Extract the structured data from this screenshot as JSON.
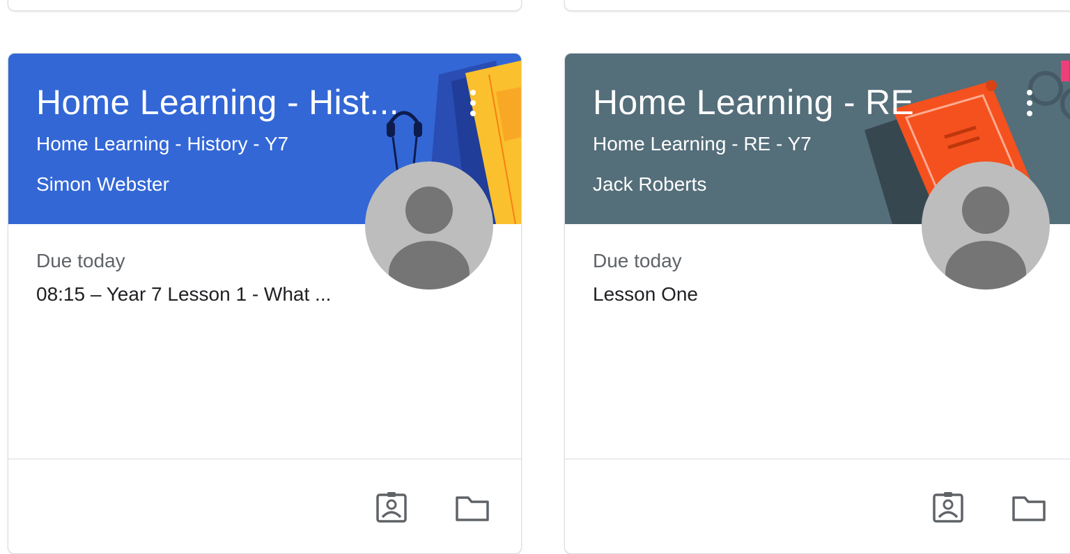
{
  "cards": [
    {
      "title": "Home Learning - Hist...",
      "section": "Home Learning - History - Y7",
      "teacher": "Simon Webster",
      "due_label": "Due today",
      "due_item": "08:15 – Year 7 Lesson 1 - What ...",
      "theme_color": "#3367d6",
      "more_icon": "more-vert-icon",
      "footer_icons": [
        "assignment-ind-icon",
        "folder-icon"
      ]
    },
    {
      "title": "Home Learning - RE",
      "section": "Home Learning - RE - Y7",
      "teacher": "Jack Roberts",
      "due_label": "Due today",
      "due_item": "Lesson One",
      "theme_color": "#546e7a",
      "more_icon": "more-vert-icon",
      "footer_icons": [
        "assignment-ind-icon",
        "folder-icon"
      ]
    }
  ],
  "colors": {
    "history_banner": "#3367d6",
    "re_banner": "#546e7a",
    "avatar_bg": "#bdbdbd",
    "avatar_fg": "#757575",
    "divider": "#dadce0",
    "icon_gray": "#5f6368"
  }
}
